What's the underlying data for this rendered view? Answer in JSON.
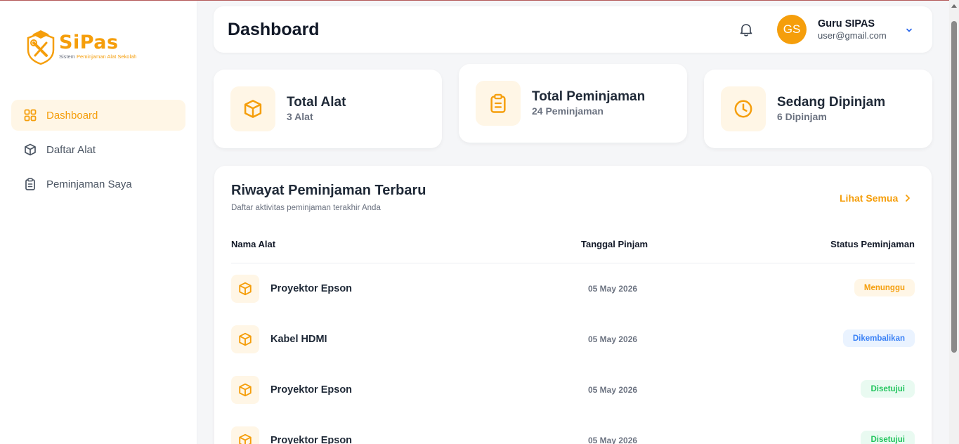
{
  "brand": {
    "name": "SiPas",
    "tagline_prefix": "Sistem ",
    "tagline_highlight": "Peminjaman Alat Sekolah",
    "color": "#f59e0b"
  },
  "sidebar": {
    "items": [
      {
        "label": "Dashboard",
        "icon": "grid-icon",
        "active": true
      },
      {
        "label": "Daftar Alat",
        "icon": "box-icon",
        "active": false
      },
      {
        "label": "Peminjaman Saya",
        "icon": "clipboard-icon",
        "active": false
      }
    ]
  },
  "header": {
    "title": "Dashboard",
    "user": {
      "initials": "GS",
      "name": "Guru SIPAS",
      "email": "user@gmail.com"
    }
  },
  "stats": [
    {
      "title": "Total Alat",
      "sub": "3 Alat",
      "icon": "box-icon"
    },
    {
      "title": "Total Peminjaman",
      "sub": "24 Peminjaman",
      "icon": "clipboard-icon"
    },
    {
      "title": "Sedang Dipinjam",
      "sub": "6 Dipinjam",
      "icon": "clock-icon"
    }
  ],
  "history": {
    "title": "Riwayat Peminjaman Terbaru",
    "subtitle": "Daftar aktivitas peminjaman terakhir Anda",
    "see_all": "Lihat Semua",
    "columns": [
      "Nama Alat",
      "Tanggal Pinjam",
      "Status Peminjaman"
    ],
    "rows": [
      {
        "name": "Proyektor Epson",
        "date": "05 May 2026",
        "status": "Menunggu",
        "status_type": "menunggu"
      },
      {
        "name": "Kabel HDMI",
        "date": "05 May 2026",
        "status": "Dikembalikan",
        "status_type": "dikembalikan"
      },
      {
        "name": "Proyektor Epson",
        "date": "05 May 2026",
        "status": "Disetujui",
        "status_type": "disetujui"
      },
      {
        "name": "Proyektor Epson",
        "date": "05 May 2026",
        "status": "Disetujui",
        "status_type": "disetujui"
      }
    ]
  },
  "colors": {
    "accent": "#f59e0b",
    "accent_soft": "#fff6e6",
    "info": "#3b82f6",
    "success": "#22c55e"
  }
}
